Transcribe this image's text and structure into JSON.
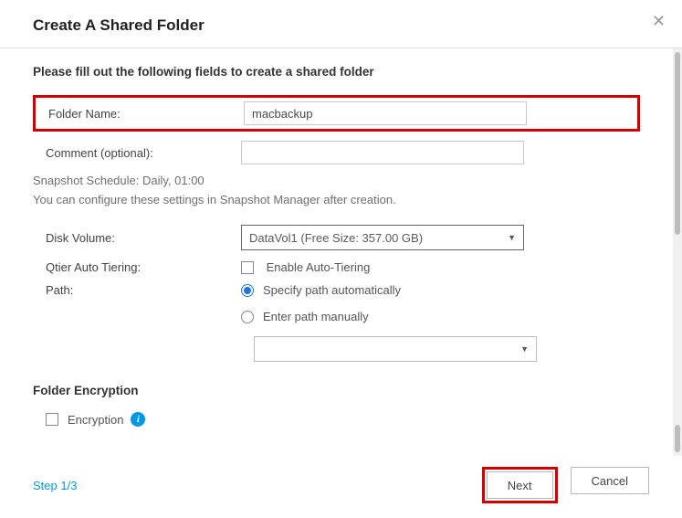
{
  "header": {
    "title": "Create A Shared Folder"
  },
  "instructions": "Please fill out the following fields to create a shared folder",
  "fields": {
    "folderName": {
      "label": "Folder Name:",
      "value": "macbackup"
    },
    "comment": {
      "label": "Comment (optional):",
      "value": ""
    },
    "snapshot": "Snapshot Schedule: Daily, 01:00",
    "snapshotNote": "You can configure these settings in Snapshot Manager after creation.",
    "diskVolume": {
      "label": "Disk Volume:",
      "value": "DataVol1 (Free Size: 357.00 GB)"
    },
    "qtier": {
      "label": "Qtier Auto Tiering:",
      "checkLabel": "Enable Auto-Tiering"
    },
    "path": {
      "label": "Path:",
      "opt1": "Specify path automatically",
      "opt2": "Enter path manually"
    }
  },
  "encryption": {
    "heading": "Folder Encryption",
    "label": "Encryption"
  },
  "footer": {
    "step": "Step 1/3",
    "next": "Next",
    "cancel": "Cancel"
  }
}
